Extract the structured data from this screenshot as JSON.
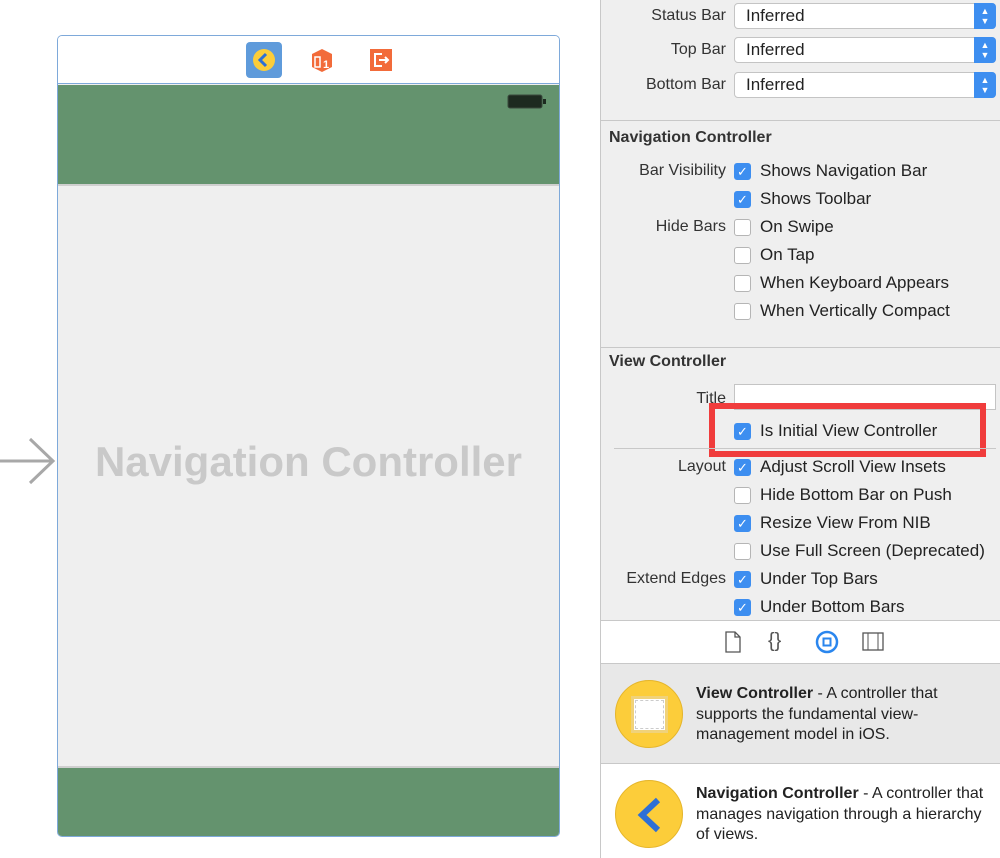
{
  "canvas": {
    "scene_title": "Navigation Controller",
    "scene_icons": [
      "navigation-controller-icon",
      "first-responder-icon",
      "exit-icon"
    ]
  },
  "colors": {
    "bar_green": "#64936e",
    "accent": "#3d8ef0",
    "highlight": "#f03c3c",
    "scene_border": "#7ea9da"
  },
  "inspector": {
    "simulated": [
      {
        "label": "Status Bar",
        "value": "Inferred"
      },
      {
        "label": "Top Bar",
        "value": "Inferred"
      },
      {
        "label": "Bottom Bar",
        "value": "Inferred"
      }
    ],
    "nav_section": "Navigation Controller",
    "nav_rows": [
      {
        "group": "Bar Visibility",
        "label": "Shows Navigation Bar",
        "checked": true
      },
      {
        "group": "",
        "label": "Shows Toolbar",
        "checked": true
      },
      {
        "group": "Hide Bars",
        "label": "On Swipe",
        "checked": false
      },
      {
        "group": "",
        "label": "On Tap",
        "checked": false
      },
      {
        "group": "",
        "label": "When Keyboard Appears",
        "checked": false
      },
      {
        "group": "",
        "label": "When Vertically Compact",
        "checked": false
      }
    ],
    "vc_section": "View Controller",
    "title_label": "Title",
    "title_value": "",
    "initial": {
      "label": "Is Initial View Controller",
      "checked": true
    },
    "vc_rows": [
      {
        "group": "Layout",
        "label": "Adjust Scroll View Insets",
        "checked": true
      },
      {
        "group": "",
        "label": "Hide Bottom Bar on Push",
        "checked": false
      },
      {
        "group": "",
        "label": "Resize View From NIB",
        "checked": true
      },
      {
        "group": "",
        "label": "Use Full Screen (Deprecated)",
        "checked": false
      },
      {
        "group": "Extend Edges",
        "label": "Under Top Bars",
        "checked": true
      },
      {
        "group": "",
        "label": "Under Bottom Bars",
        "checked": true
      }
    ]
  },
  "library_tabs": [
    "file-template-icon",
    "code-snippet-icon",
    "object-library-icon",
    "media-library-icon"
  ],
  "library": [
    {
      "name": "View Controller",
      "desc": " - A controller that supports the fundamental view-management model in iOS."
    },
    {
      "name": "Navigation Controller",
      "desc": " - A controller that manages navigation through a hierarchy of views."
    }
  ]
}
